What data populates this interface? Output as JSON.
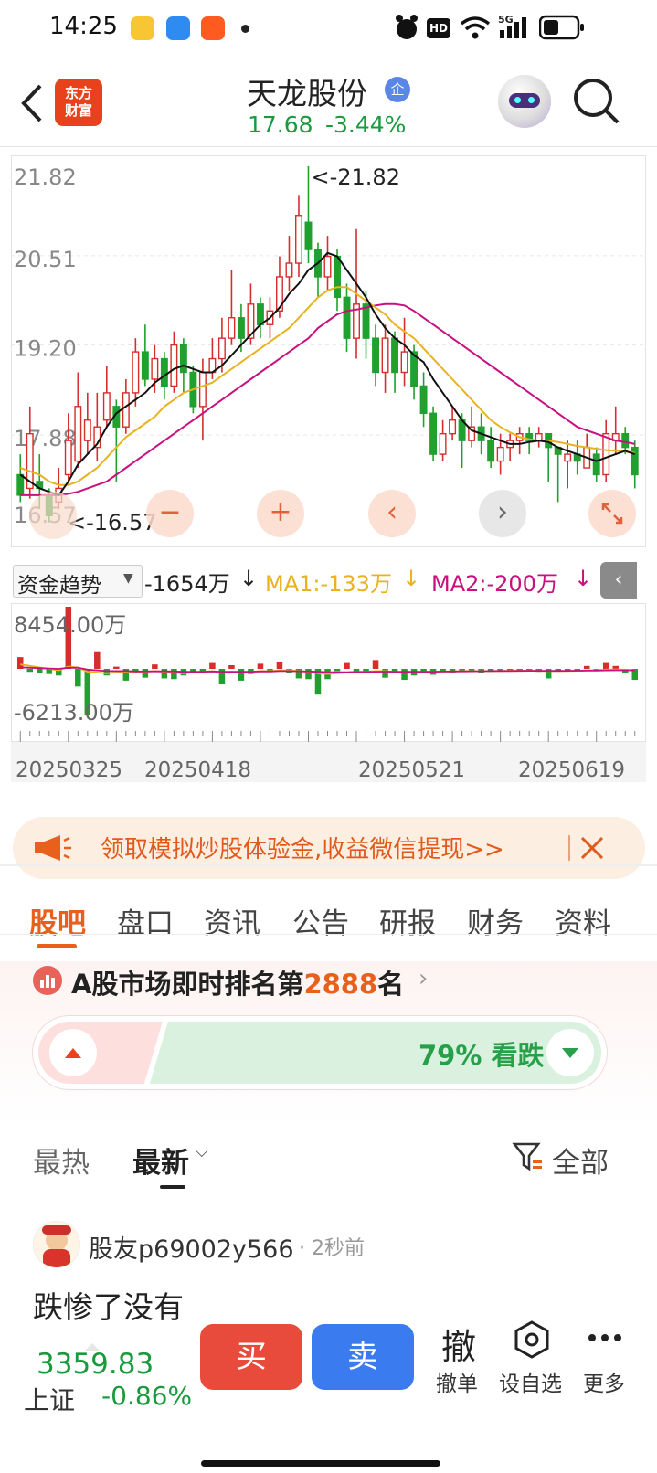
{
  "status_bar": {
    "time": "14:25",
    "signal": "5G",
    "hd": "HD"
  },
  "header": {
    "logo_line1": "东方",
    "logo_line2": "财富",
    "stock_name": "天龙股份",
    "badge": "企",
    "price": "17.68",
    "change_pct": "-3.44%"
  },
  "kline": {
    "y_labels": [
      "21.82",
      "20.51",
      "19.20",
      "17.88",
      "16.57"
    ],
    "max_label": "<-21.82",
    "min_label": "<-16.57",
    "controls": [
      "−",
      "+",
      "‹",
      "›"
    ],
    "up_color": "#d62d2d",
    "down_color": "#20a02e",
    "ma5_color": "#111111",
    "ma10_color": "#e8b220",
    "ma20_color": "#c8107f"
  },
  "chart_data": {
    "type": "candlestick",
    "y_range": [
      16.57,
      21.82
    ],
    "x_labels": [
      "20250325",
      "20250418",
      "20250521",
      "20250619"
    ],
    "max_value": 21.82,
    "min_value": 16.57,
    "candles": [
      [
        17.3,
        17.0,
        17.6,
        16.9
      ],
      [
        17.1,
        17.9,
        18.3,
        16.95
      ],
      [
        17.2,
        17.1,
        17.6,
        16.8
      ],
      [
        17.0,
        16.7,
        17.1,
        16.6
      ],
      [
        16.9,
        17.1,
        17.4,
        16.8
      ],
      [
        17.3,
        17.8,
        18.2,
        17.2
      ],
      [
        17.5,
        18.3,
        18.8,
        17.4
      ],
      [
        17.8,
        18.1,
        18.5,
        17.6
      ],
      [
        17.7,
        18.0,
        18.5,
        17.5
      ],
      [
        18.1,
        18.5,
        18.9,
        18.0
      ],
      [
        18.3,
        18.0,
        18.4,
        17.2
      ],
      [
        18.0,
        18.5,
        18.7,
        17.9
      ],
      [
        18.5,
        19.1,
        19.3,
        18.3
      ],
      [
        19.1,
        18.7,
        19.5,
        18.6
      ],
      [
        18.7,
        19.0,
        19.2,
        18.5
      ],
      [
        19.0,
        18.6,
        19.1,
        18.4
      ],
      [
        18.6,
        19.2,
        19.4,
        18.5
      ],
      [
        19.2,
        18.8,
        19.3,
        18.5
      ],
      [
        18.8,
        18.3,
        18.9,
        18.2
      ],
      [
        18.3,
        18.8,
        19.0,
        17.8
      ],
      [
        18.8,
        19.0,
        19.3,
        18.7
      ],
      [
        19.0,
        19.3,
        19.6,
        18.8
      ],
      [
        19.3,
        19.6,
        20.3,
        19.2
      ],
      [
        19.6,
        19.3,
        19.8,
        19.1
      ],
      [
        19.3,
        19.8,
        20.1,
        19.2
      ],
      [
        19.8,
        19.5,
        19.9,
        19.3
      ],
      [
        19.5,
        19.7,
        19.9,
        19.3
      ],
      [
        19.7,
        20.2,
        20.5,
        19.6
      ],
      [
        20.2,
        20.4,
        20.8,
        20.0
      ],
      [
        20.4,
        21.1,
        21.4,
        20.2
      ],
      [
        21.0,
        20.6,
        21.82,
        20.4
      ],
      [
        20.6,
        20.2,
        20.7,
        19.9
      ],
      [
        20.2,
        20.5,
        20.8,
        20.0
      ],
      [
        20.5,
        19.9,
        20.6,
        19.7
      ],
      [
        19.9,
        19.3,
        20.1,
        19.1
      ],
      [
        19.3,
        19.8,
        20.9,
        19.0
      ],
      [
        19.8,
        19.3,
        20.0,
        19.0
      ],
      [
        19.3,
        18.8,
        19.5,
        18.6
      ],
      [
        18.8,
        19.3,
        19.5,
        18.5
      ],
      [
        19.3,
        18.8,
        19.4,
        18.5
      ],
      [
        18.8,
        19.1,
        19.6,
        18.6
      ],
      [
        19.1,
        18.6,
        19.2,
        18.4
      ],
      [
        18.6,
        18.2,
        18.8,
        18.0
      ],
      [
        18.2,
        17.6,
        18.3,
        17.5
      ],
      [
        17.6,
        17.9,
        18.1,
        17.5
      ],
      [
        17.9,
        18.1,
        18.3,
        17.8
      ],
      [
        18.1,
        17.8,
        18.2,
        17.4
      ],
      [
        17.8,
        18.0,
        18.3,
        17.7
      ],
      [
        18.0,
        17.8,
        18.2,
        17.6
      ],
      [
        17.8,
        17.5,
        18.0,
        17.4
      ],
      [
        17.5,
        17.7,
        17.9,
        17.3
      ],
      [
        17.7,
        17.8,
        17.9,
        17.5
      ],
      [
        17.8,
        17.9,
        18.0,
        17.6
      ],
      [
        17.9,
        17.8,
        18.0,
        17.6
      ],
      [
        17.8,
        17.9,
        18.0,
        17.7
      ],
      [
        17.9,
        17.7,
        17.9,
        17.2
      ],
      [
        17.7,
        17.6,
        17.7,
        16.9
      ],
      [
        17.5,
        17.6,
        17.8,
        17.1
      ],
      [
        17.6,
        17.5,
        17.8,
        17.3
      ],
      [
        17.4,
        17.7,
        17.9,
        17.4
      ],
      [
        17.6,
        17.3,
        17.7,
        17.2
      ],
      [
        17.3,
        17.9,
        18.1,
        17.2
      ],
      [
        17.8,
        17.9,
        18.3,
        17.6
      ],
      [
        17.9,
        17.7,
        18.0,
        17.6
      ],
      [
        17.7,
        17.3,
        17.8,
        17.1
      ]
    ],
    "ma5": [
      17.3,
      17.2,
      17.1,
      17.05,
      17.0,
      17.2,
      17.45,
      17.6,
      17.75,
      18.0,
      18.2,
      18.3,
      18.4,
      18.5,
      18.65,
      18.75,
      18.85,
      18.9,
      18.85,
      18.8,
      18.8,
      18.9,
      19.05,
      19.2,
      19.35,
      19.5,
      19.6,
      19.75,
      19.95,
      20.1,
      20.3,
      20.4,
      20.55,
      20.5,
      20.3,
      20.1,
      19.9,
      19.65,
      19.45,
      19.3,
      19.2,
      19.05,
      18.95,
      18.7,
      18.5,
      18.3,
      18.1,
      17.95,
      17.9,
      17.85,
      17.8,
      17.75,
      17.75,
      17.78,
      17.8,
      17.78,
      17.7,
      17.65,
      17.6,
      17.55,
      17.5,
      17.55,
      17.6,
      17.65,
      17.6
    ],
    "ma10": [
      17.4,
      17.35,
      17.3,
      17.2,
      17.15,
      17.15,
      17.2,
      17.3,
      17.4,
      17.55,
      17.7,
      17.85,
      17.95,
      18.05,
      18.15,
      18.3,
      18.4,
      18.5,
      18.55,
      18.6,
      18.65,
      18.75,
      18.85,
      18.95,
      19.05,
      19.15,
      19.25,
      19.35,
      19.45,
      19.6,
      19.75,
      19.9,
      20.0,
      20.05,
      20.05,
      19.95,
      19.85,
      19.75,
      19.65,
      19.5,
      19.4,
      19.3,
      19.15,
      19.0,
      18.85,
      18.7,
      18.55,
      18.4,
      18.25,
      18.1,
      18.0,
      17.92,
      17.85,
      17.82,
      17.8,
      17.8,
      17.78,
      17.75,
      17.72,
      17.7,
      17.68,
      17.66,
      17.65,
      17.64,
      17.62
    ],
    "ma20": [
      17.0,
      17.0,
      17.0,
      17.0,
      17.0,
      17.02,
      17.05,
      17.1,
      17.15,
      17.2,
      17.3,
      17.4,
      17.5,
      17.6,
      17.7,
      17.8,
      17.9,
      18.0,
      18.1,
      18.2,
      18.3,
      18.4,
      18.5,
      18.6,
      18.7,
      18.8,
      18.9,
      19.0,
      19.1,
      19.2,
      19.3,
      19.45,
      19.55,
      19.65,
      19.7,
      19.72,
      19.75,
      19.78,
      19.8,
      19.8,
      19.78,
      19.7,
      19.6,
      19.5,
      19.4,
      19.3,
      19.2,
      19.1,
      19.0,
      18.9,
      18.8,
      18.7,
      18.6,
      18.5,
      18.4,
      18.3,
      18.2,
      18.1,
      18.0,
      17.95,
      17.9,
      17.85,
      17.8,
      17.78,
      17.75
    ],
    "flow_range": [
      -6213,
      8454
    ],
    "flow": [
      1600,
      -400,
      -600,
      -700,
      -900,
      8454,
      -2400,
      -6213,
      2400,
      -900,
      300,
      -1600,
      -400,
      -1200,
      600,
      -1300,
      -1400,
      -900,
      -600,
      -300,
      800,
      -2000,
      500,
      -1600,
      -700,
      700,
      -400,
      1000,
      -500,
      -1300,
      -1400,
      -3500,
      -1400,
      -300,
      800,
      -600,
      -300,
      1200,
      -1200,
      -500,
      -1500,
      -900,
      -300,
      -800,
      -400,
      -600,
      -200,
      -300,
      -500,
      -400,
      -200,
      -300,
      -200,
      -300,
      -400,
      -1300,
      -300,
      -200,
      -300,
      400,
      -300,
      800,
      400,
      -600,
      -1500
    ],
    "flow_ma1": [
      600,
      400,
      200,
      0,
      -200,
      300,
      200,
      -400,
      -500,
      -600,
      -500,
      -400,
      -500,
      -400,
      -300,
      -400,
      -500,
      -600,
      -500,
      -400,
      -300,
      -500,
      -400,
      -500,
      -400,
      -300,
      -300,
      -200,
      -200,
      -300,
      -400,
      -600,
      -700,
      -600,
      -500,
      -400,
      -400,
      -300,
      -300,
      -400,
      -500,
      -500,
      -400,
      -400,
      -350,
      -350,
      -300,
      -300,
      -300,
      -300,
      -280,
      -250,
      -250,
      -250,
      -260,
      -300,
      -300,
      -280,
      -260,
      -200,
      -180,
      -100,
      -80,
      -100,
      -200
    ],
    "flow_ma2": [
      200,
      150,
      100,
      50,
      0,
      150,
      150,
      -100,
      -200,
      -300,
      -300,
      -300,
      -350,
      -350,
      -320,
      -330,
      -350,
      -400,
      -400,
      -380,
      -350,
      -380,
      -380,
      -400,
      -380,
      -350,
      -340,
      -300,
      -300,
      -320,
      -340,
      -400,
      -450,
      -450,
      -440,
      -420,
      -410,
      -380,
      -370,
      -380,
      -400,
      -400,
      -380,
      -380,
      -360,
      -350,
      -330,
      -320,
      -310,
      -300,
      -290,
      -280,
      -270,
      -260,
      -260,
      -270,
      -270,
      -260,
      -250,
      -230,
      -220,
      -200,
      -190,
      -190,
      -200
    ]
  },
  "indicator": {
    "selector": "资金趋势",
    "value": "-1654万",
    "ma1": "MA1:-133万",
    "ma2": "MA2:-200万",
    "arrow": "↓",
    "top_label": "8454.00万",
    "bottom_label": "-6213.00万"
  },
  "dates": [
    "20250325",
    "20250418",
    "20250521",
    "20250619"
  ],
  "banner": {
    "text": "领取模拟炒股体验金,收益微信提现>>"
  },
  "tabs": [
    {
      "label": "股吧",
      "active": true
    },
    {
      "label": "盘口",
      "active": false
    },
    {
      "label": "资讯",
      "active": false
    },
    {
      "label": "公告",
      "active": false
    },
    {
      "label": "研报",
      "active": false
    },
    {
      "label": "财务",
      "active": false
    },
    {
      "label": "资料",
      "active": false
    }
  ],
  "ranking": {
    "prefix": "A股市场即时排名第",
    "rank": "2888",
    "suffix": "名",
    "sentiment": "79% 看跌",
    "down_fraction": 0.79
  },
  "filter": {
    "hot": "最热",
    "latest": "最新",
    "all": "全部"
  },
  "post": {
    "user": "股友p69002y566",
    "time": "· 2秒前",
    "content": "跌惨了没有"
  },
  "bottom": {
    "index_value": "3359.83",
    "index_name": "上证",
    "index_change": "-0.86%",
    "buy": "买",
    "sell": "卖",
    "cancel_icon": "撤",
    "cancel": "撤单",
    "watch": "设自选",
    "more": "更多"
  }
}
